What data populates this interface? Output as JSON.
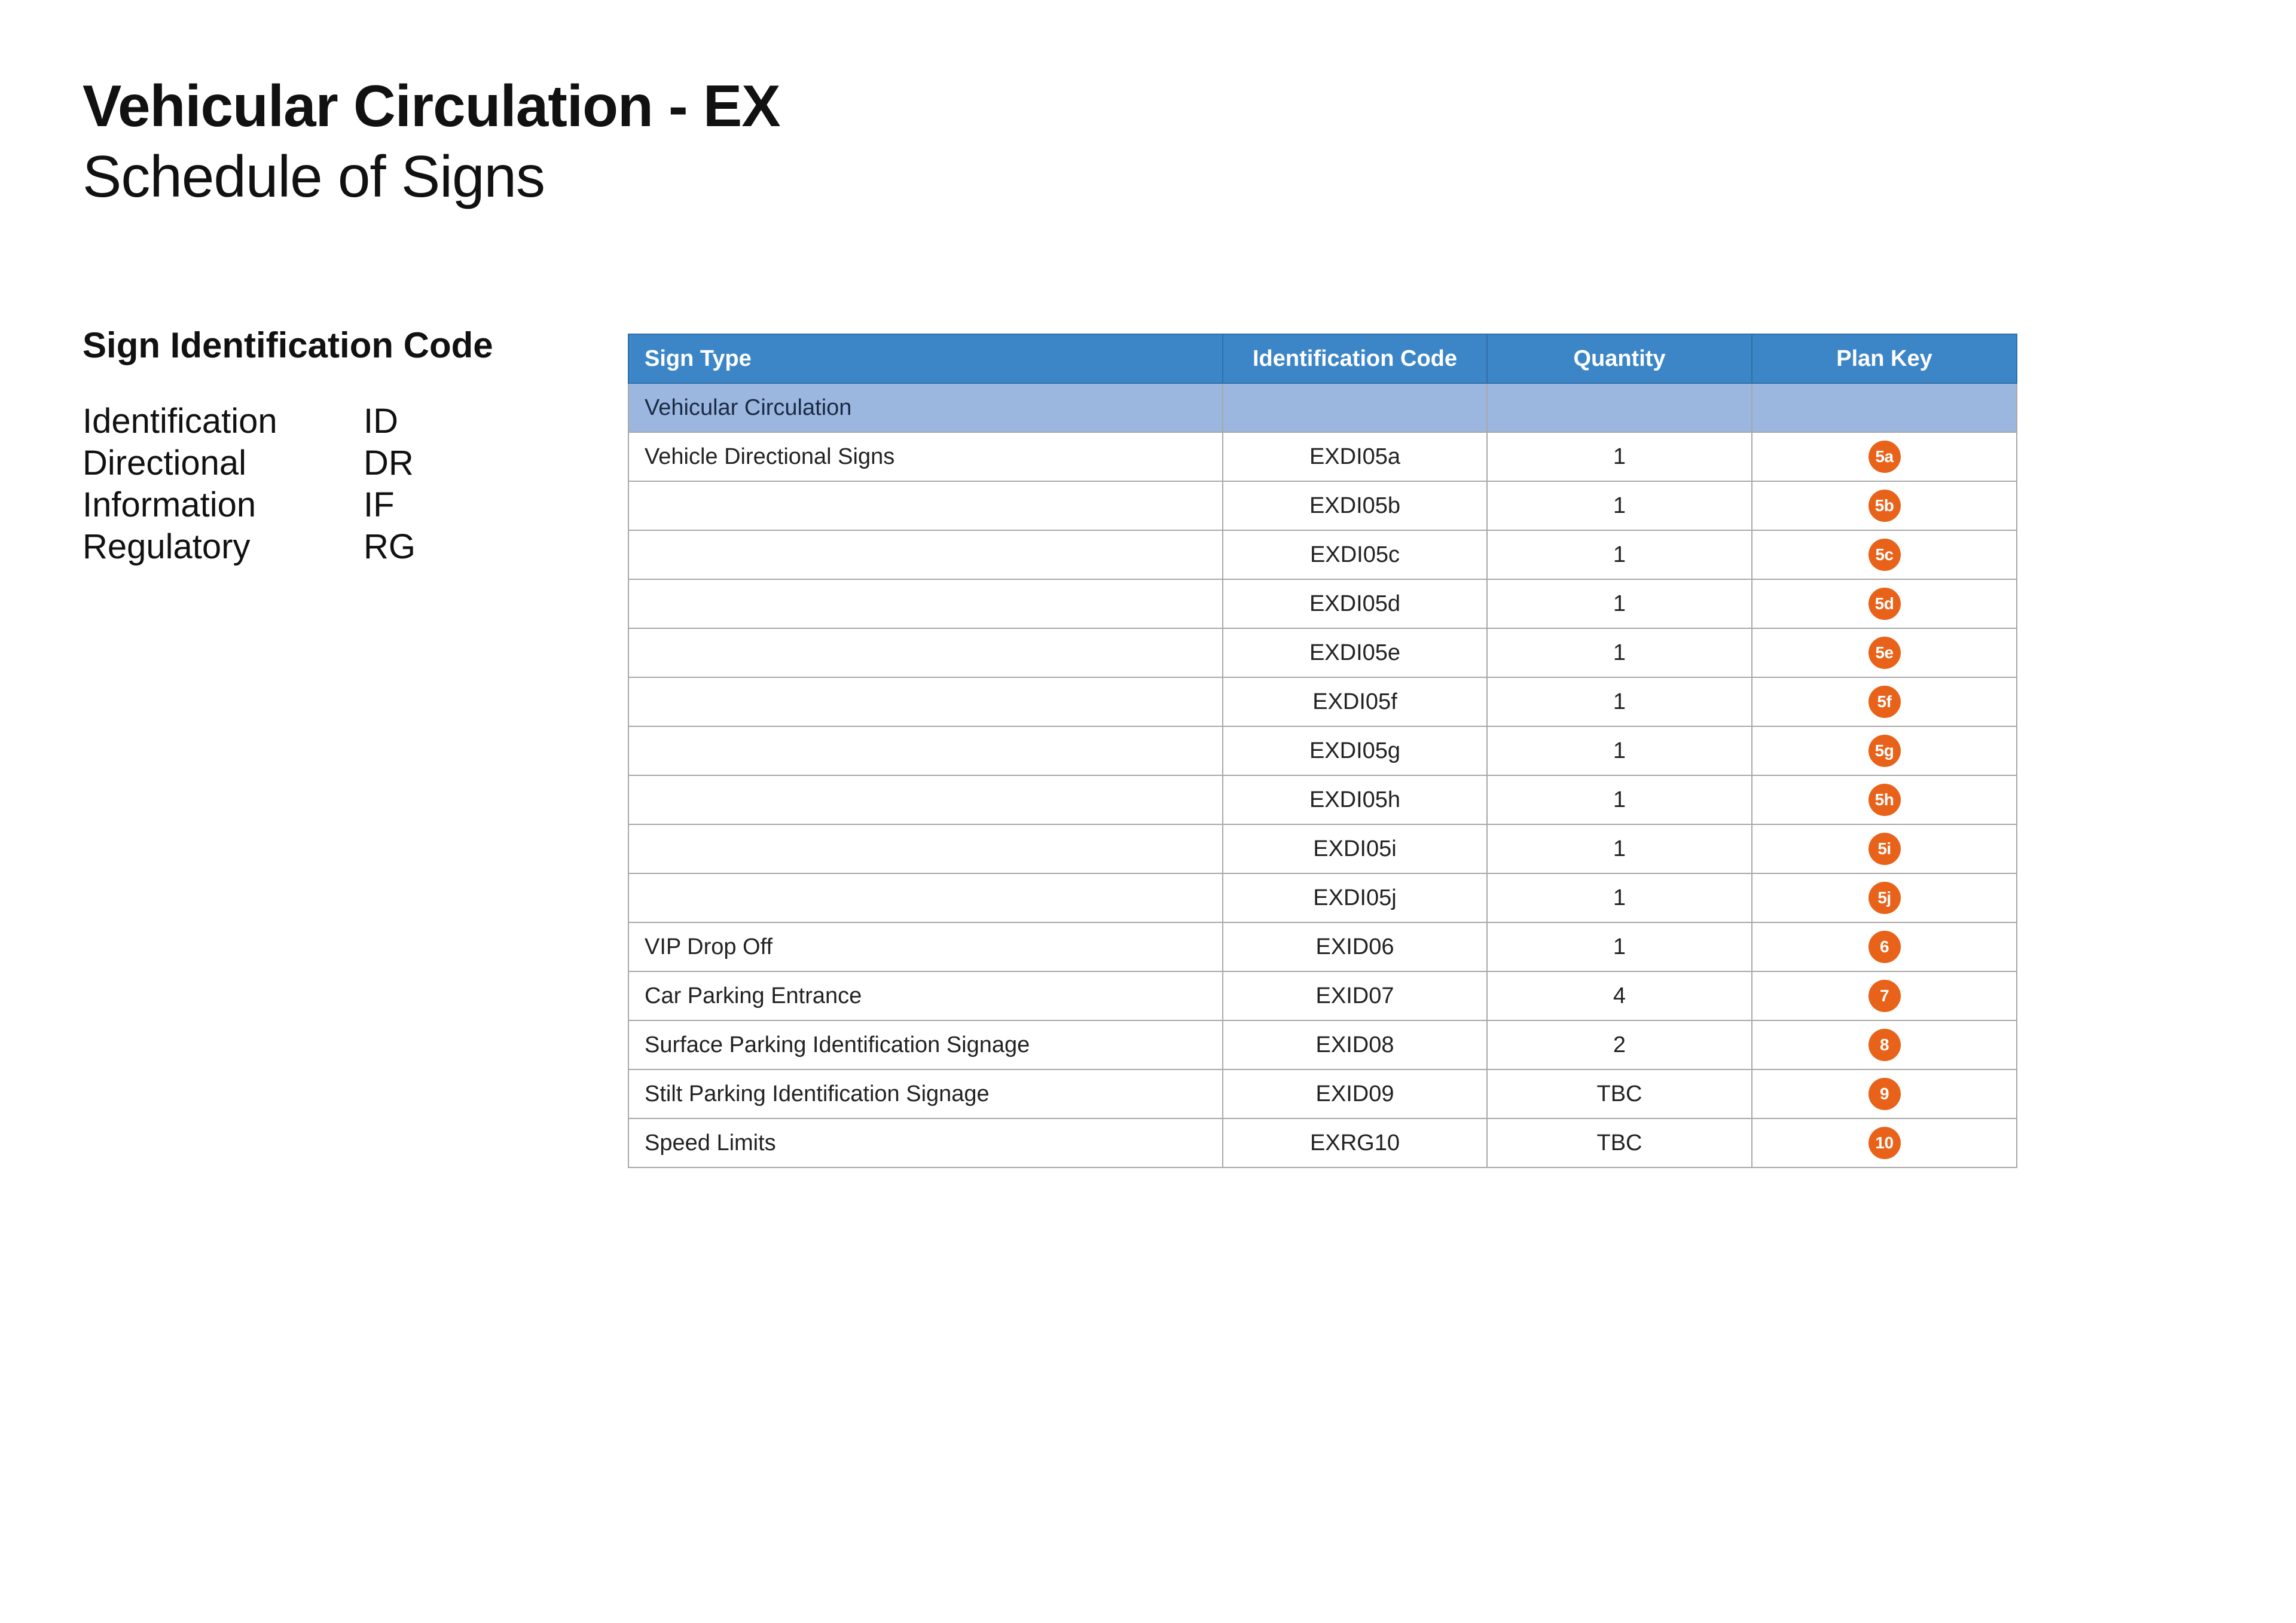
{
  "title": {
    "line1": "Vehicular Circulation - EX",
    "line2": "Schedule of Signs"
  },
  "legend": {
    "heading": "Sign Identification Code",
    "items": [
      {
        "name": "Identification",
        "code": "ID"
      },
      {
        "name": "Directional",
        "code": "DR"
      },
      {
        "name": "Information",
        "code": "IF"
      },
      {
        "name": "Regulatory",
        "code": "RG"
      }
    ]
  },
  "table": {
    "headers": [
      "Sign Type",
      "Identification Code",
      "Quantity",
      "Plan Key"
    ],
    "group": "Vehicular Circulation",
    "rows": [
      {
        "type": "Vehicle Directional Signs",
        "code": "EXDI05a",
        "qty": "1",
        "key": "5a"
      },
      {
        "type": "",
        "code": "EXDI05b",
        "qty": "1",
        "key": "5b"
      },
      {
        "type": "",
        "code": "EXDI05c",
        "qty": "1",
        "key": "5c"
      },
      {
        "type": "",
        "code": "EXDI05d",
        "qty": "1",
        "key": "5d"
      },
      {
        "type": "",
        "code": "EXDI05e",
        "qty": "1",
        "key": "5e"
      },
      {
        "type": "",
        "code": "EXDI05f",
        "qty": "1",
        "key": "5f"
      },
      {
        "type": "",
        "code": "EXDI05g",
        "qty": "1",
        "key": "5g"
      },
      {
        "type": "",
        "code": "EXDI05h",
        "qty": "1",
        "key": "5h"
      },
      {
        "type": "",
        "code": "EXDI05i",
        "qty": "1",
        "key": "5i"
      },
      {
        "type": "",
        "code": "EXDI05j",
        "qty": "1",
        "key": "5j"
      },
      {
        "type": "VIP Drop Off",
        "code": "EXID06",
        "qty": "1",
        "key": "6"
      },
      {
        "type": "Car Parking Entrance",
        "code": "EXID07",
        "qty": "4",
        "key": "7"
      },
      {
        "type": "Surface Parking Identification Signage",
        "code": "EXID08",
        "qty": "2",
        "key": "8"
      },
      {
        "type": "Stilt Parking Identification Signage",
        "code": "EXID09",
        "qty": "TBC",
        "key": "9"
      },
      {
        "type": "Speed Limits",
        "code": "EXRG10",
        "qty": "TBC",
        "key": "10"
      }
    ]
  },
  "colors": {
    "header_bg": "#3c86c8",
    "group_bg": "#9bb7e0",
    "badge": "#e8621a"
  }
}
